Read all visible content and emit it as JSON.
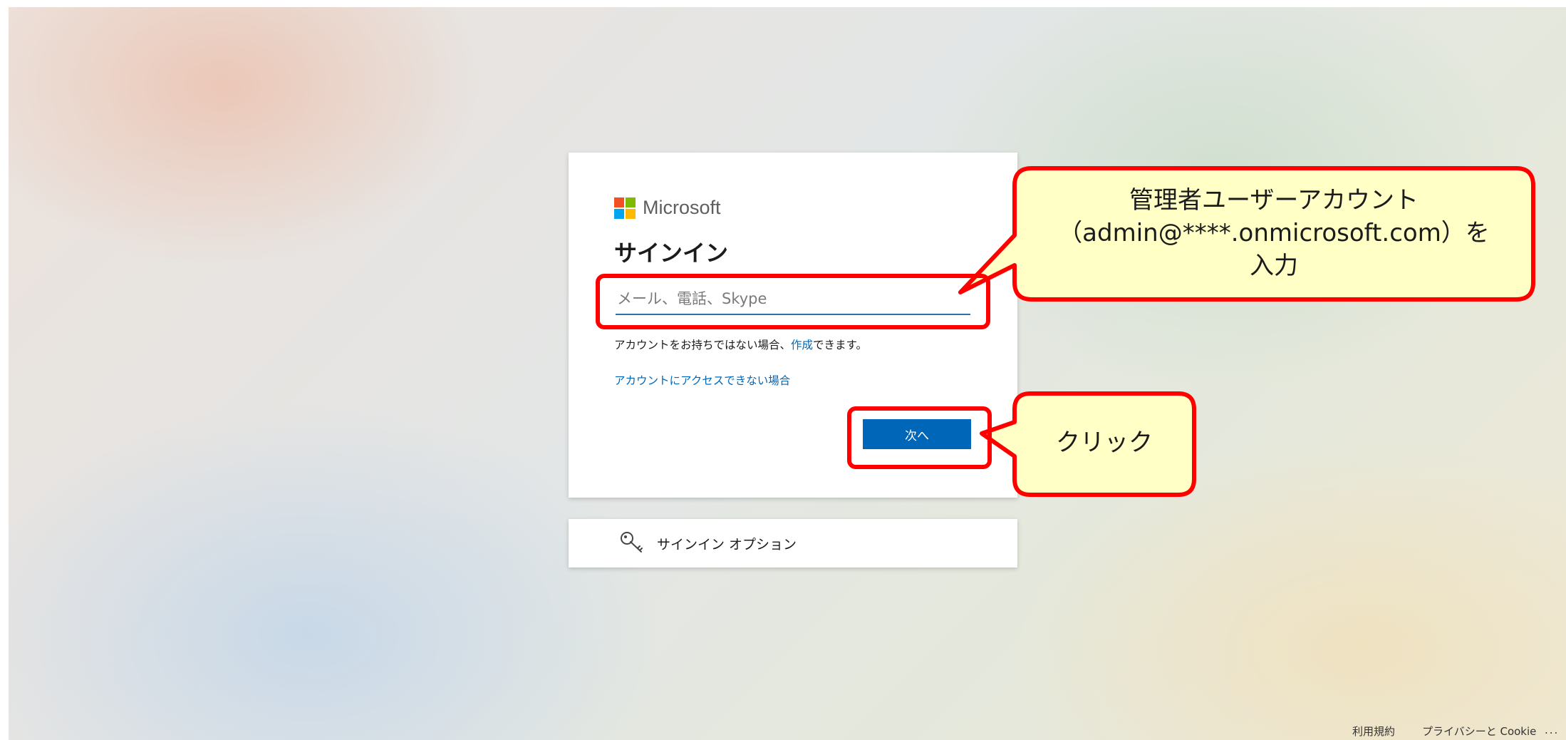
{
  "brand": {
    "name": "Microsoft",
    "colors": [
      "#f25022",
      "#7fba00",
      "#00a4ef",
      "#ffb900"
    ]
  },
  "signin": {
    "title": "サインイン",
    "email_placeholder": "メール、電話、Skype",
    "no_account_prefix": "アカウントをお持ちではない場合、",
    "create_link": "作成",
    "no_account_suffix": "できます。",
    "cant_access_link": "アカウントにアクセスできない場合",
    "next_button": "次へ",
    "accent_color": "#0067b8"
  },
  "options": {
    "icon": "key-icon",
    "label": "サインイン オプション"
  },
  "callouts": {
    "account": {
      "line1": "管理者ユーザーアカウント",
      "line2": "（admin@****.onmicrosoft.com）を",
      "line3": "入力"
    },
    "click": {
      "text": "クリック"
    }
  },
  "footer": {
    "terms": "利用規約",
    "privacy": "プライバシーと Cookie",
    "more": "..."
  }
}
